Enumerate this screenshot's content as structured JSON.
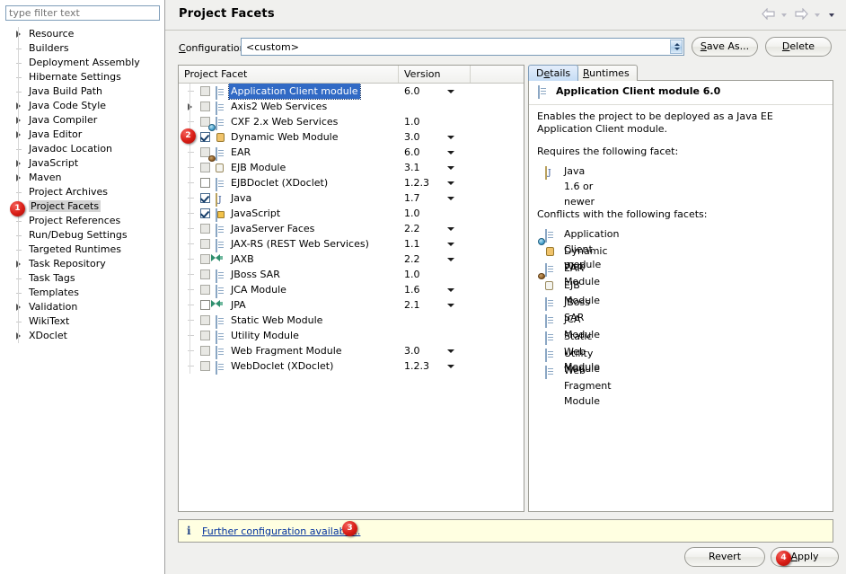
{
  "sidebar": {
    "filter_placeholder": "type filter text",
    "items": [
      {
        "label": "Resource",
        "expandable": true,
        "selected": false
      },
      {
        "label": "Builders",
        "expandable": false,
        "selected": false
      },
      {
        "label": "Deployment Assembly",
        "expandable": false,
        "selected": false
      },
      {
        "label": "Hibernate Settings",
        "expandable": false,
        "selected": false
      },
      {
        "label": "Java Build Path",
        "expandable": false,
        "selected": false
      },
      {
        "label": "Java Code Style",
        "expandable": true,
        "selected": false
      },
      {
        "label": "Java Compiler",
        "expandable": true,
        "selected": false
      },
      {
        "label": "Java Editor",
        "expandable": true,
        "selected": false
      },
      {
        "label": "Javadoc Location",
        "expandable": false,
        "selected": false
      },
      {
        "label": "JavaScript",
        "expandable": true,
        "selected": false
      },
      {
        "label": "Maven",
        "expandable": true,
        "selected": false
      },
      {
        "label": "Project Archives",
        "expandable": false,
        "selected": false
      },
      {
        "label": "Project Facets",
        "expandable": false,
        "selected": true
      },
      {
        "label": "Project References",
        "expandable": false,
        "selected": false
      },
      {
        "label": "Run/Debug Settings",
        "expandable": false,
        "selected": false
      },
      {
        "label": "Targeted Runtimes",
        "expandable": false,
        "selected": false
      },
      {
        "label": "Task Repository",
        "expandable": true,
        "selected": false
      },
      {
        "label": "Task Tags",
        "expandable": false,
        "selected": false
      },
      {
        "label": "Templates",
        "expandable": false,
        "selected": false
      },
      {
        "label": "Validation",
        "expandable": true,
        "selected": false
      },
      {
        "label": "WikiText",
        "expandable": false,
        "selected": false
      },
      {
        "label": "XDoclet",
        "expandable": true,
        "selected": false
      }
    ]
  },
  "header": {
    "title": "Project Facets",
    "back_icon": "back-arrow-icon",
    "forward_icon": "forward-arrow-icon",
    "menu_icon": "view-menu-caret-icon"
  },
  "configuration": {
    "label": "Configuration:",
    "value": "<custom>",
    "save_as_label": "Save As...",
    "delete_label": "Delete"
  },
  "facet_table": {
    "columns": [
      "Project Facet",
      "Version",
      ""
    ],
    "rows": [
      {
        "name": "Application Client module",
        "version": "6.0",
        "checked": false,
        "enabled": false,
        "selected": true,
        "expandable": false,
        "has_version_dropdown": true,
        "icon": "doc"
      },
      {
        "name": "Axis2 Web Services",
        "version": "",
        "checked": false,
        "enabled": false,
        "selected": false,
        "expandable": true,
        "has_version_dropdown": false,
        "icon": "doc"
      },
      {
        "name": "CXF 2.x Web Services",
        "version": "1.0",
        "checked": false,
        "enabled": false,
        "selected": false,
        "expandable": false,
        "has_version_dropdown": false,
        "icon": "doc"
      },
      {
        "name": "Dynamic Web Module",
        "version": "3.0",
        "checked": true,
        "enabled": true,
        "selected": false,
        "expandable": false,
        "has_version_dropdown": true,
        "icon": "web"
      },
      {
        "name": "EAR",
        "version": "6.0",
        "checked": false,
        "enabled": false,
        "selected": false,
        "expandable": false,
        "has_version_dropdown": true,
        "icon": "doc"
      },
      {
        "name": "EJB Module",
        "version": "3.1",
        "checked": false,
        "enabled": false,
        "selected": false,
        "expandable": false,
        "has_version_dropdown": true,
        "icon": "ejb"
      },
      {
        "name": "EJBDoclet (XDoclet)",
        "version": "1.2.3",
        "checked": false,
        "enabled": true,
        "selected": false,
        "expandable": false,
        "has_version_dropdown": true,
        "icon": "doc"
      },
      {
        "name": "Java",
        "version": "1.7",
        "checked": true,
        "enabled": true,
        "selected": false,
        "expandable": false,
        "has_version_dropdown": true,
        "icon": "java"
      },
      {
        "name": "JavaScript",
        "version": "1.0",
        "checked": true,
        "enabled": true,
        "selected": false,
        "expandable": false,
        "has_version_dropdown": false,
        "icon": "js"
      },
      {
        "name": "JavaServer Faces",
        "version": "2.2",
        "checked": false,
        "enabled": false,
        "selected": false,
        "expandable": false,
        "has_version_dropdown": true,
        "icon": "doc"
      },
      {
        "name": "JAX-RS (REST Web Services)",
        "version": "1.1",
        "checked": false,
        "enabled": false,
        "selected": false,
        "expandable": false,
        "has_version_dropdown": true,
        "icon": "doc"
      },
      {
        "name": "JAXB",
        "version": "2.2",
        "checked": false,
        "enabled": false,
        "selected": false,
        "expandable": false,
        "has_version_dropdown": true,
        "icon": "arrows"
      },
      {
        "name": "JBoss SAR",
        "version": "1.0",
        "checked": false,
        "enabled": false,
        "selected": false,
        "expandable": false,
        "has_version_dropdown": false,
        "icon": "doc"
      },
      {
        "name": "JCA Module",
        "version": "1.6",
        "checked": false,
        "enabled": false,
        "selected": false,
        "expandable": false,
        "has_version_dropdown": true,
        "icon": "doc"
      },
      {
        "name": "JPA",
        "version": "2.1",
        "checked": false,
        "enabled": true,
        "selected": false,
        "expandable": false,
        "has_version_dropdown": true,
        "icon": "arrows"
      },
      {
        "name": "Static Web Module",
        "version": "",
        "checked": false,
        "enabled": false,
        "selected": false,
        "expandable": false,
        "has_version_dropdown": false,
        "icon": "doc"
      },
      {
        "name": "Utility Module",
        "version": "",
        "checked": false,
        "enabled": false,
        "selected": false,
        "expandable": false,
        "has_version_dropdown": false,
        "icon": "doc"
      },
      {
        "name": "Web Fragment Module",
        "version": "3.0",
        "checked": false,
        "enabled": false,
        "selected": false,
        "expandable": false,
        "has_version_dropdown": true,
        "icon": "doc"
      },
      {
        "name": "WebDoclet (XDoclet)",
        "version": "1.2.3",
        "checked": false,
        "enabled": false,
        "selected": false,
        "expandable": false,
        "has_version_dropdown": true,
        "icon": "doc"
      }
    ]
  },
  "details": {
    "tabs": [
      {
        "label": "Details",
        "active": true
      },
      {
        "label": "Runtimes",
        "active": false
      }
    ],
    "facet_title": "Application Client module 6.0",
    "description": "Enables the project to be deployed as a Java EE Application Client module.",
    "requires_heading": "Requires the following facet:",
    "requires": [
      {
        "label": "Java 1.6 or newer",
        "icon": "java"
      }
    ],
    "conflicts_heading": "Conflicts with the following facets:",
    "conflicts": [
      {
        "label": "Application Client module",
        "icon": "doc"
      },
      {
        "label": "Dynamic Web Module",
        "icon": "web"
      },
      {
        "label": "EAR",
        "icon": "doc"
      },
      {
        "label": "EJB Module",
        "icon": "ejb"
      },
      {
        "label": "JBoss SAR",
        "icon": "doc"
      },
      {
        "label": "JCA Module",
        "icon": "doc"
      },
      {
        "label": "Static Web Module",
        "icon": "doc"
      },
      {
        "label": "Utility Module",
        "icon": "doc"
      },
      {
        "label": "Web Fragment Module",
        "icon": "doc"
      }
    ]
  },
  "info_bar": {
    "icon": "info-icon",
    "message": "Further configuration available.."
  },
  "footer": {
    "revert_label": "Revert",
    "apply_label": "Apply"
  },
  "annotations": [
    {
      "number": "1",
      "target": "sidebar-item-project-facets"
    },
    {
      "number": "2",
      "target": "facet-checkbox-dynamic-web-module"
    },
    {
      "number": "3",
      "target": "further-configuration-link"
    },
    {
      "number": "4",
      "target": "apply-button"
    }
  ],
  "colors": {
    "selection_blue": "#316ac5",
    "info_background": "#ffffe1",
    "badge_red": "#d81c15",
    "link_blue": "#00309c"
  }
}
